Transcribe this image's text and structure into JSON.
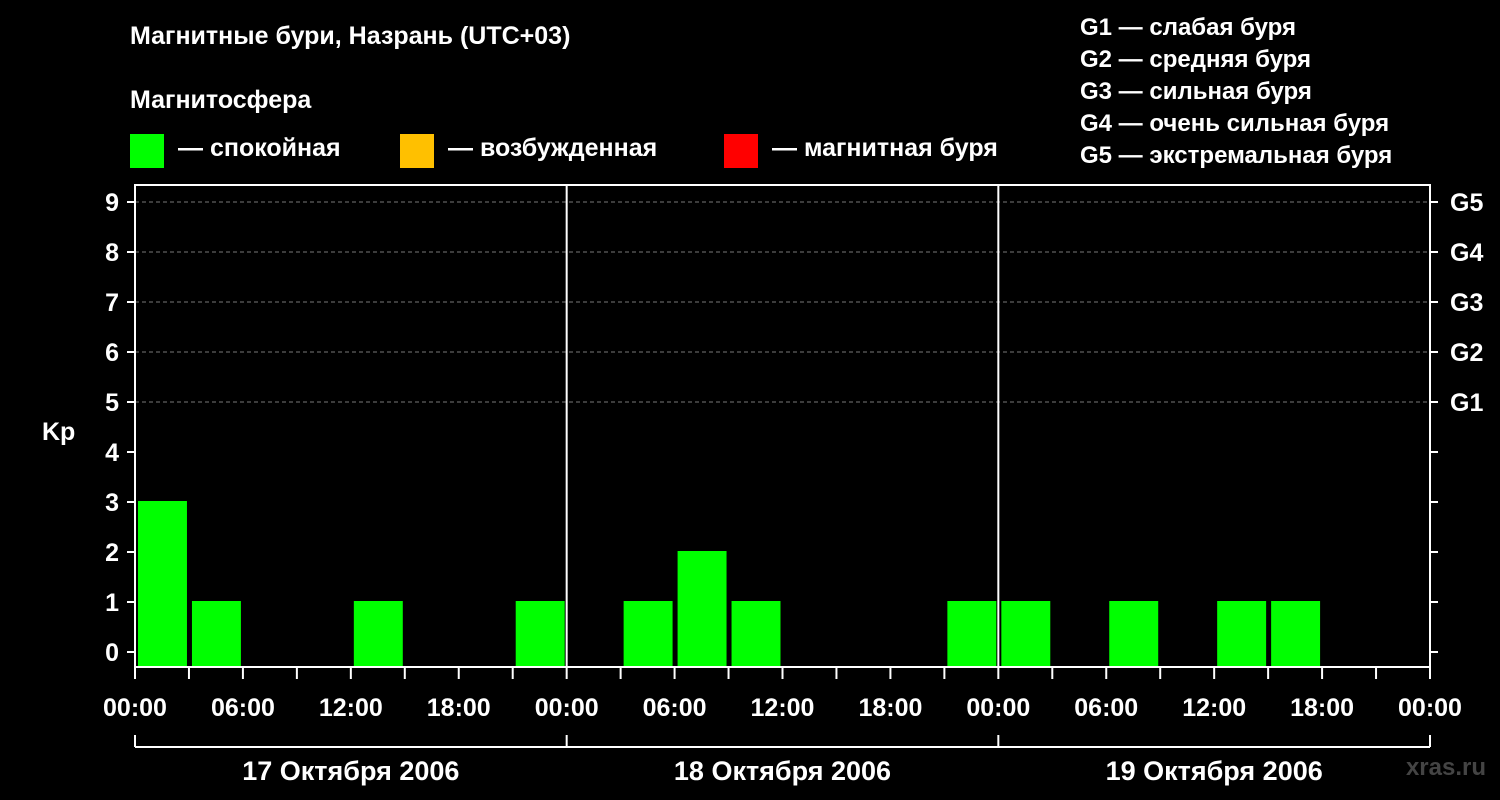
{
  "title": "Магнитные бури, Назрань (UTC+03)",
  "magnetosphere_label": "Магнитосфера",
  "states": [
    {
      "label": "— спокойная",
      "color": "#00ff00"
    },
    {
      "label": "— возбужденная",
      "color": "#ffc000"
    },
    {
      "label": "— магнитная буря",
      "color": "#ff0000"
    }
  ],
  "g_scale": [
    "G1 — слабая буря",
    "G2 — средняя буря",
    "G3 — сильная буря",
    "G4 — очень сильная буря",
    "G5 — экстремальная буря"
  ],
  "brand": "xras.ru",
  "chart_data": {
    "type": "bar",
    "ylabel": "Kp",
    "ylim": [
      0,
      9
    ],
    "y_ticks": [
      "0",
      "1",
      "2",
      "3",
      "4",
      "5",
      "6",
      "7",
      "8",
      "9"
    ],
    "right_ticks": [
      {
        "kp": 5,
        "label": "G1"
      },
      {
        "kp": 6,
        "label": "G2"
      },
      {
        "kp": 7,
        "label": "G3"
      },
      {
        "kp": 8,
        "label": "G4"
      },
      {
        "kp": 9,
        "label": "G5"
      }
    ],
    "x_tick_labels": [
      "00:00",
      "06:00",
      "12:00",
      "18:00",
      "00:00",
      "06:00",
      "12:00",
      "18:00",
      "00:00",
      "06:00",
      "12:00",
      "18:00",
      "00:00"
    ],
    "days": [
      "17 Октября 2006",
      "18 Октября 2006",
      "19 Октября 2006"
    ],
    "interval_hours": 3,
    "series": [
      {
        "values": [
          3,
          1,
          0,
          0,
          1,
          0,
          0,
          1,
          0,
          1,
          2,
          1,
          0,
          0,
          0,
          1,
          1,
          0,
          1,
          0,
          1,
          1,
          0,
          0
        ]
      }
    ],
    "bar_color": "#00ff00",
    "grid": "dashed at Kp 5-9"
  }
}
